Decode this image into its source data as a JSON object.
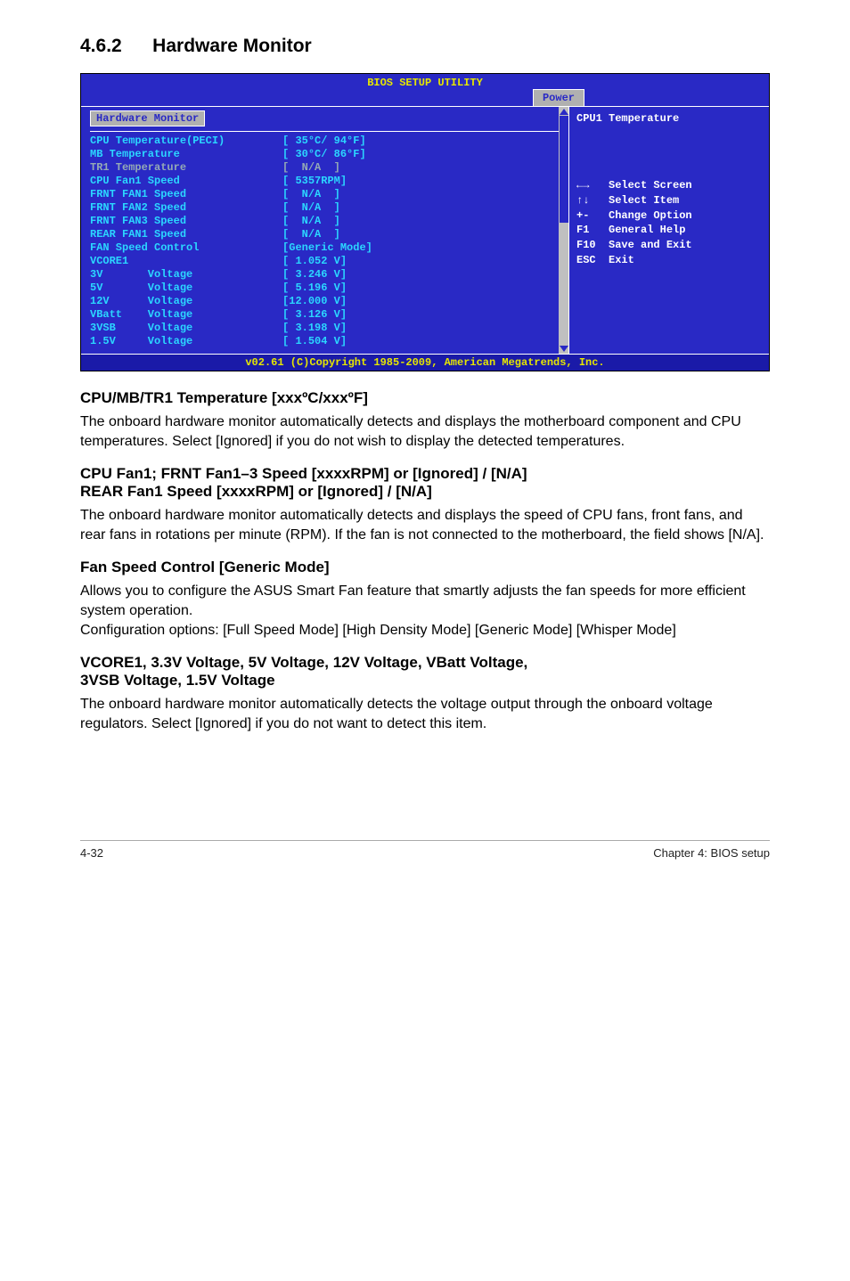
{
  "section": {
    "number": "4.6.2",
    "title": "Hardware Monitor"
  },
  "bios": {
    "headerTitle": "BIOS SETUP UTILITY",
    "tab": "Power",
    "panelTitle": "Hardware Monitor",
    "rows": [
      {
        "label": "CPU Temperature(PECI)",
        "value": "[ 35°C/ 94°F]",
        "gray": false
      },
      {
        "label": "MB Temperature",
        "value": "[ 30°C/ 86°F]",
        "gray": false
      },
      {
        "label": "TR1 Temperature",
        "value": "[  N/A  ]",
        "gray": true
      },
      {
        "label": "CPU Fan1 Speed",
        "value": "[ 5357RPM]",
        "gray": false
      },
      {
        "label": "FRNT FAN1 Speed",
        "value": "[  N/A  ]",
        "gray": false
      },
      {
        "label": "FRNT FAN2 Speed",
        "value": "[  N/A  ]",
        "gray": false
      },
      {
        "label": "FRNT FAN3 Speed",
        "value": "[  N/A  ]",
        "gray": false
      },
      {
        "label": "REAR FAN1 Speed",
        "value": "[  N/A  ]",
        "gray": false
      },
      {
        "label": "FAN Speed Control",
        "value": "[Generic Mode]",
        "gray": false
      },
      {
        "label": "VCORE1",
        "value": "[ 1.052 V]",
        "gray": false
      },
      {
        "label": "3V       Voltage",
        "value": "[ 3.246 V]",
        "gray": false
      },
      {
        "label": "5V       Voltage",
        "value": "[ 5.196 V]",
        "gray": false
      },
      {
        "label": "12V      Voltage",
        "value": "[12.000 V]",
        "gray": false
      },
      {
        "label": "VBatt    Voltage",
        "value": "[ 3.126 V]",
        "gray": false
      },
      {
        "label": "3VSB     Voltage",
        "value": "[ 3.198 V]",
        "gray": false
      },
      {
        "label": "1.5V     Voltage",
        "value": "[ 1.504 V]",
        "gray": false
      }
    ],
    "help": {
      "title": "CPU1 Temperature",
      "nav1": "←→   Select Screen",
      "nav2": "↑↓   Select Item",
      "nav3": "+-   Change Option",
      "nav4": "F1   General Help",
      "nav5": "F10  Save and Exit",
      "nav6": "ESC  Exit"
    },
    "footer": "v02.61 (C)Copyright 1985-2009, American Megatrends, Inc."
  },
  "sub1": {
    "heading": "CPU/MB/TR1 Temperature [xxxºC/xxxºF]",
    "body": "The onboard hardware monitor automatically detects and displays the motherboard component and CPU temperatures. Select [Ignored] if you do not wish to display the detected temperatures."
  },
  "sub2": {
    "headingA": "CPU Fan1; FRNT Fan1–3 Speed [xxxxRPM] or [Ignored] / [N/A]",
    "headingB": "REAR Fan1 Speed [xxxxRPM] or [Ignored] / [N/A]",
    "body": "The onboard hardware monitor automatically detects and displays the speed of CPU fans, front fans, and rear fans in rotations per minute (RPM). If the fan is not connected to the motherboard, the field shows [N/A]."
  },
  "sub3": {
    "heading": "Fan Speed Control [Generic Mode]",
    "body1": "Allows you to configure the ASUS Smart Fan feature that smartly adjusts the fan speeds for more efficient system operation.",
    "body2": "Configuration options: [Full Speed Mode] [High Density Mode] [Generic Mode] [Whisper Mode]"
  },
  "sub4": {
    "headingA": "VCORE1, 3.3V Voltage, 5V Voltage, 12V Voltage, VBatt Voltage,",
    "headingB": "3VSB Voltage, 1.5V Voltage",
    "body": "The onboard hardware monitor automatically detects the voltage output through the onboard voltage regulators. Select [Ignored] if you do not want to detect this item."
  },
  "footer": {
    "left": "4-32",
    "right": "Chapter 4: BIOS setup"
  }
}
